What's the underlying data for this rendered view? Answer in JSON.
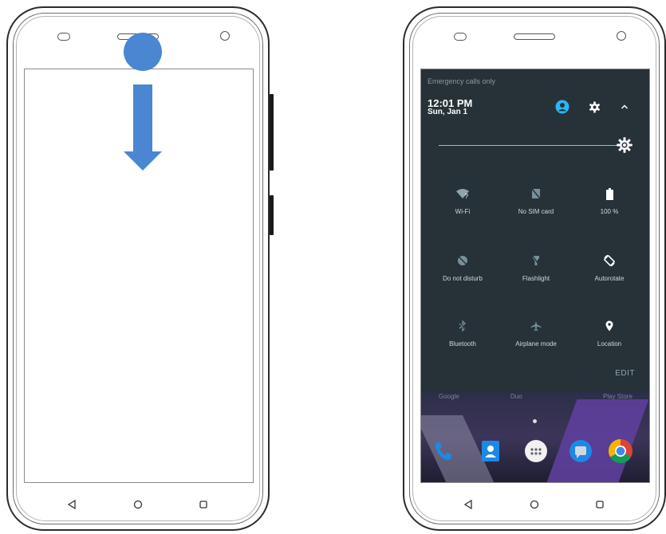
{
  "shade": {
    "header": "Emergency calls only",
    "time": "12:01 PM",
    "date": "Sun, Jan 1",
    "tiles": [
      {
        "label": "Wi-Fi",
        "icon": "wifi-icon"
      },
      {
        "label": "No SIM card",
        "icon": "no-sim-icon"
      },
      {
        "label": "100 %",
        "icon": "battery-icon"
      },
      {
        "label": "Do not disturb",
        "icon": "do-not-disturb-icon"
      },
      {
        "label": "Flashlight",
        "icon": "flashlight-icon"
      },
      {
        "label": "Autorotate",
        "icon": "autorotate-icon"
      },
      {
        "label": "Bluetooth",
        "icon": "bluetooth-icon"
      },
      {
        "label": "Airplane mode",
        "icon": "airplane-icon"
      },
      {
        "label": "Location",
        "icon": "location-icon"
      }
    ],
    "edit_label": "EDIT"
  },
  "homescreen": {
    "labels": [
      "Google",
      "Duo",
      "Play Store"
    ],
    "dock": [
      "phone-app-icon",
      "contacts-app-icon",
      "app-drawer-icon",
      "messages-app-icon",
      "chrome-icon"
    ]
  },
  "colors": {
    "shade_bg": "#263238",
    "accent_teal": "#80cbc4",
    "touch_blue": "#4a86d2",
    "user_cyan": "#29b6f6"
  }
}
